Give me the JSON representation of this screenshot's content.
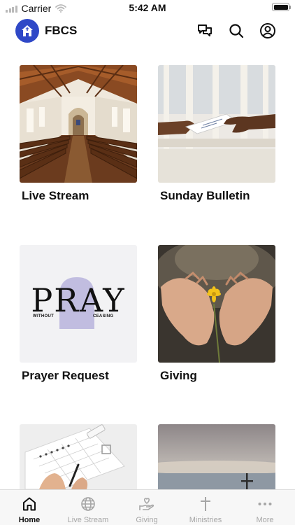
{
  "status_bar": {
    "carrier": "Carrier",
    "time": "5:42 AM"
  },
  "header": {
    "brand": "FBCS",
    "icons": [
      "home-icon",
      "chat-icon",
      "search-icon",
      "profile-icon"
    ]
  },
  "cards": [
    {
      "label": "Live Stream"
    },
    {
      "label": "Sunday Bulletin"
    },
    {
      "label": "Prayer Request",
      "image_text": {
        "word": "PRAY",
        "left": "WITHOUT",
        "right": "CEASING"
      }
    },
    {
      "label": "Giving"
    }
  ],
  "tabs": [
    {
      "label": "Home",
      "active": true
    },
    {
      "label": "Live Stream",
      "active": false
    },
    {
      "label": "Giving",
      "active": false
    },
    {
      "label": "Ministries",
      "active": false
    },
    {
      "label": "More",
      "active": false
    }
  ],
  "colors": {
    "brand": "#2f48c7",
    "tab_active": "#111111",
    "tab_inactive": "#a6a6a6"
  }
}
